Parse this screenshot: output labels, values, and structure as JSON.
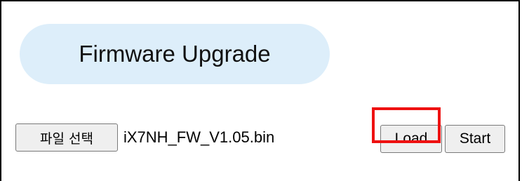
{
  "header": {
    "title": "Firmware Upgrade"
  },
  "file_picker": {
    "button_label": "파일 선택",
    "selected_file": "iX7NH_FW_V1.05.bin"
  },
  "actions": {
    "load_label": "Load",
    "start_label": "Start"
  },
  "colors": {
    "title_pill_background": "#ddeefa",
    "highlight_outline": "#ee1111",
    "button_background": "#efefef",
    "frame_border": "#000000"
  }
}
